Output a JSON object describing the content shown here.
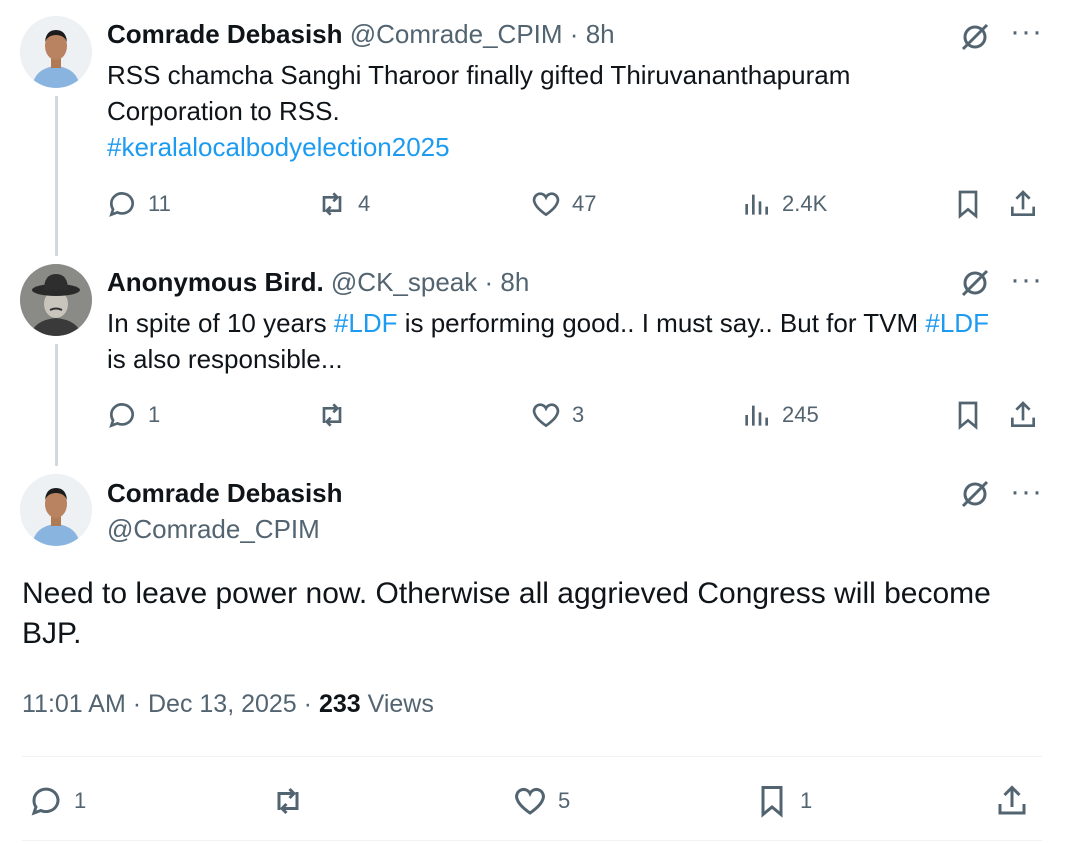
{
  "replies": [
    {
      "name": "Comrade Debasish",
      "handle": "@Comrade_CPIM",
      "time": "8h",
      "text_line1": "RSS chamcha Sanghi Tharoor finally gifted Thiruvananthapuram",
      "text_line2": "Corporation to RSS.",
      "hashtag": "#keralalocalbodyelection2025",
      "replies": "11",
      "reposts": "4",
      "likes": "47",
      "views": "2.4K"
    },
    {
      "name": "Anonymous Bird.",
      "handle": "@CK_speak",
      "time": "8h",
      "text_a": "In spite of 10 years ",
      "hashtag_a": "#LDF",
      "text_b": " is performing good.. I must say.. But for TVM ",
      "hashtag_b": "#LDF",
      "text_line2": "is also responsible...",
      "replies": "1",
      "reposts": "",
      "likes": "3",
      "views": "245"
    }
  ],
  "main_post": {
    "name": "Comrade Debasish",
    "handle": "@Comrade_CPIM",
    "text_line1": "Need to leave power now. Otherwise all aggrieved Congress will become",
    "text_line2": "BJP.",
    "timestamp": "11:01 AM · Dec 13, 2025 · ",
    "views_count": "233",
    "views_label": " Views",
    "replies": "1",
    "reposts": "",
    "likes": "5",
    "bookmarks": "1"
  },
  "colors": {
    "accent": "#1d9bf0",
    "muted": "#536471",
    "text": "#0f1419"
  }
}
